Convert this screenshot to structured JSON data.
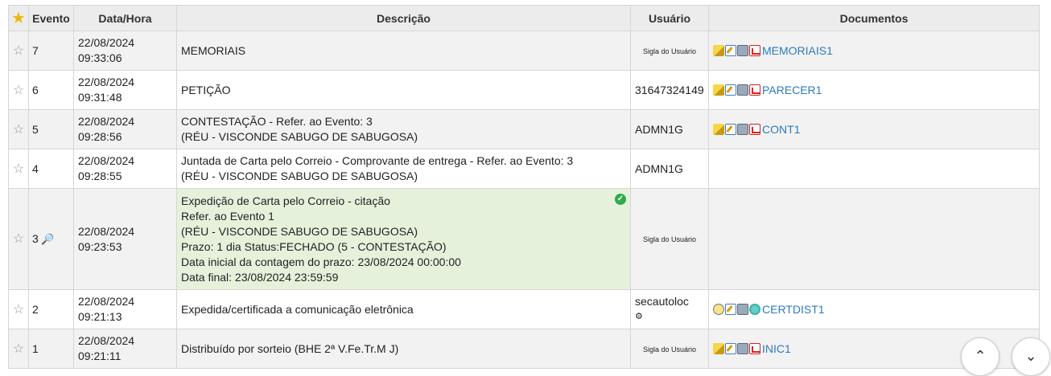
{
  "header": {
    "evento": "Evento",
    "datahora": "Data/Hora",
    "descricao": "Descrição",
    "usuario": "Usuário",
    "documentos": "Documentos"
  },
  "rows": [
    {
      "evento": "7",
      "data": "22/08/2024",
      "hora": "09:33:06",
      "desc": [
        "MEMORIAIS"
      ],
      "usuario": "Sigla do Usuário",
      "usuario_small": true,
      "doc": "MEMORIAIS1",
      "icons": [
        "pencil-icon",
        "edit-icon",
        "print-icon",
        "pdf-icon"
      ]
    },
    {
      "evento": "6",
      "data": "22/08/2024",
      "hora": "09:31:48",
      "desc": [
        "PETIÇÃO"
      ],
      "usuario": "31647324149",
      "usuario_small": false,
      "doc": "PARECER1",
      "icons": [
        "pencil-icon",
        "edit-icon",
        "print-icon",
        "pdf-icon"
      ]
    },
    {
      "evento": "5",
      "data": "22/08/2024",
      "hora": "09:28:56",
      "desc": [
        "CONTESTAÇÃO - Refer. ao Evento: 3",
        "(RÉU - VISCONDE SABUGO DE SABUGOSA)"
      ],
      "usuario": "ADMN1G",
      "usuario_small": false,
      "doc": "CONT1",
      "icons": [
        "pencil-icon",
        "edit-icon",
        "print-icon",
        "pdf-icon"
      ]
    },
    {
      "evento": "4",
      "data": "22/08/2024",
      "hora": "09:28:55",
      "desc": [
        "Juntada de Carta pelo Correio - Comprovante de entrega - Refer. ao Evento: 3",
        "(RÉU - VISCONDE SABUGO DE SABUGOSA)"
      ],
      "usuario": "ADMN1G",
      "usuario_small": false,
      "doc": "",
      "icons": []
    },
    {
      "evento": "3",
      "data": "22/08/2024",
      "hora": "09:23:53",
      "desc": [
        "Expedição de Carta pelo Correio - citação",
        "Refer. ao Evento 1",
        "(RÉU - VISCONDE SABUGO DE SABUGOSA)",
        "Prazo: 1 dia Status:FECHADO (5 - CONTESTAÇÃO)",
        "Data inicial da contagem do prazo: 23/08/2024 00:00:00",
        "Data final: 23/08/2024 23:59:59"
      ],
      "usuario": "Sigla do Usuário",
      "usuario_small": true,
      "doc": "",
      "icons": [],
      "highlight": true
    },
    {
      "evento": "2",
      "data": "22/08/2024",
      "hora": "09:21:13",
      "desc": [
        "Expedida/certificada a comunicação eletrônica"
      ],
      "usuario": "secautoloc",
      "usuario_small": false,
      "doc": "CERTDIST1",
      "icons": [
        "bubble-icon",
        "edit-icon",
        "print-icon",
        "globe-icon"
      ]
    },
    {
      "evento": "1",
      "data": "22/08/2024",
      "hora": "09:21:11",
      "desc": [
        "Distribuído por sorteio (BHE 2ª V.Fe.Tr.M J)"
      ],
      "usuario": "Sigla do Usuário",
      "usuario_small": true,
      "doc": "INIC1",
      "icons": [
        "pencil-icon",
        "edit-icon",
        "print-icon",
        "pdf-icon"
      ]
    }
  ],
  "colors": {
    "highlight_bg": "#e6f1dc",
    "link": "#2b7bbf",
    "header_bg": "#ececec"
  }
}
